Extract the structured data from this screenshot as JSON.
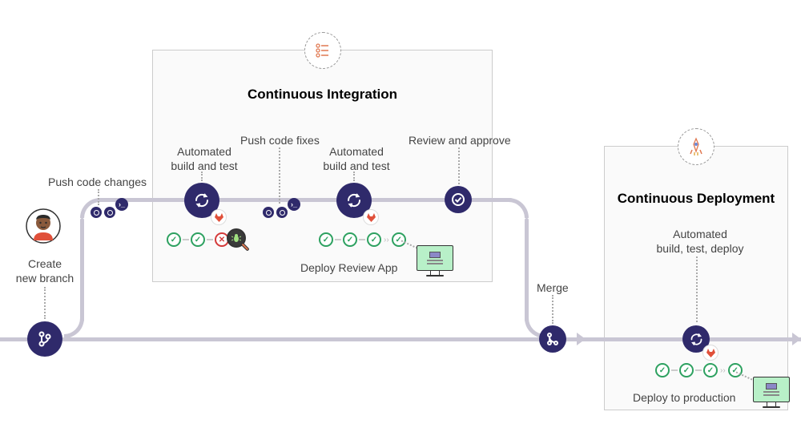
{
  "ci": {
    "title": "Continuous Integration"
  },
  "cd": {
    "title": "Continuous Deployment"
  },
  "labels": {
    "create_branch": "Create\nnew branch",
    "push_changes": "Push code changes",
    "auto_build_test_1": "Automated\nbuild and test",
    "push_fixes": "Push code fixes",
    "auto_build_test_2": "Automated\nbuild and test",
    "review_approve": "Review and approve",
    "deploy_review_app": "Deploy Review App",
    "merge": "Merge",
    "auto_build_test_deploy": "Automated\nbuild, test, deploy",
    "deploy_production": "Deploy to production"
  },
  "colors": {
    "node": "#2F2A6B",
    "line": "#c9c6d4",
    "success": "#2da160",
    "fail": "#d43a3a"
  }
}
